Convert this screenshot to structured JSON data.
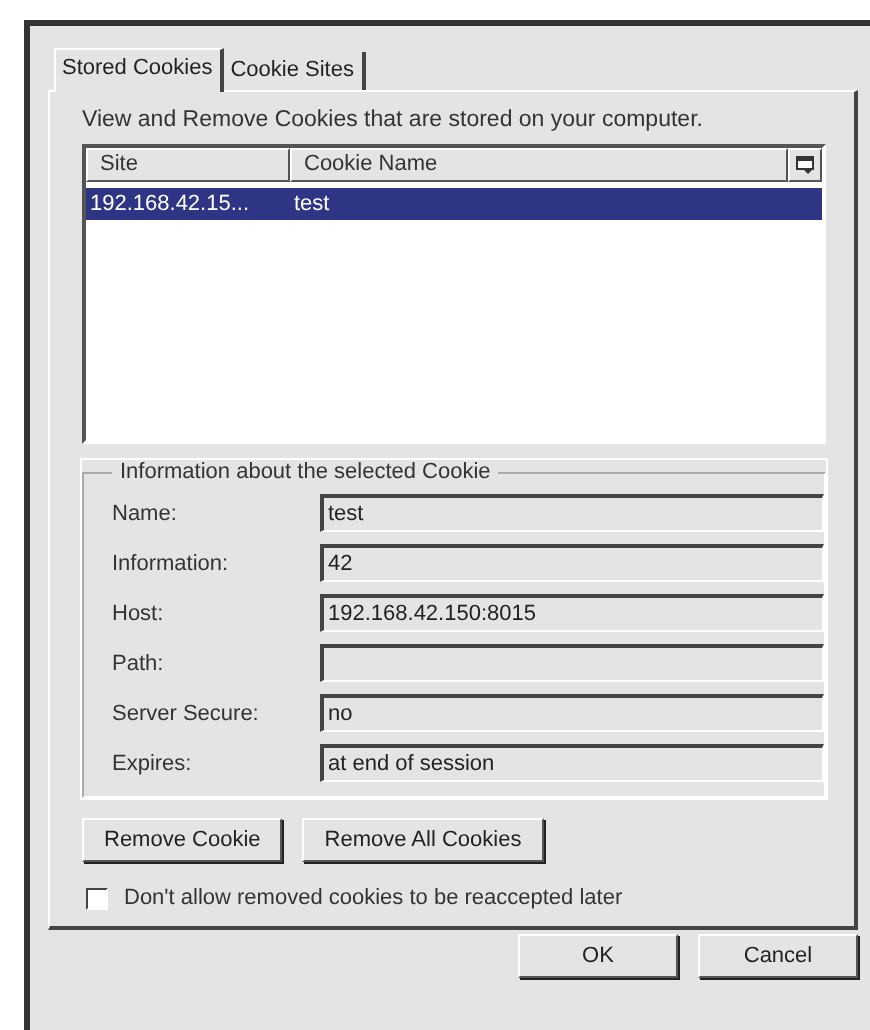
{
  "tabs": [
    {
      "label": "Stored Cookies",
      "selected": true
    },
    {
      "label": "Cookie Sites",
      "selected": false
    }
  ],
  "description": "View and Remove Cookies that are stored on your computer.",
  "table": {
    "columns": [
      "Site",
      "Cookie Name"
    ],
    "rows": [
      {
        "cells": [
          "192.168.42.15...",
          "test"
        ],
        "selected": true
      }
    ]
  },
  "info_group": {
    "title": "Information about the selected Cookie",
    "fields": [
      {
        "label": "Name:",
        "value": "test"
      },
      {
        "label": "Information:",
        "value": "42"
      },
      {
        "label": "Host:",
        "value": "192.168.42.150:8015"
      },
      {
        "label": "Path:"
      },
      {
        "label": "Server Secure:",
        "value": "no"
      },
      {
        "label": "Expires:",
        "value": "at end of session"
      }
    ]
  },
  "action_buttons": [
    "Remove Cookie",
    "Remove All Cookies"
  ],
  "checkbox": {
    "label": "Don't allow removed cookies to be reaccepted later",
    "checked": false
  },
  "dialog_buttons": [
    "OK",
    "Cancel"
  ]
}
